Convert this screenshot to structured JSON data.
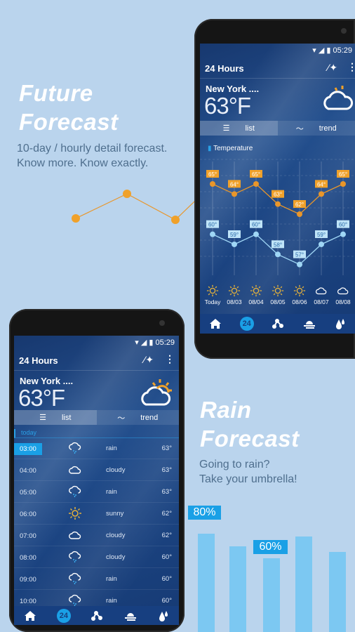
{
  "promo_future": {
    "title1": "Future",
    "title2": "Forecast",
    "sub1": "10-day / hourly detail forecast.",
    "sub2": "Know more. Know exactly."
  },
  "promo_rain": {
    "title1": "Rain",
    "title2": "Forecast",
    "sub1": "Going to rain?",
    "sub2": "Take your umbrella!",
    "bars": [
      80,
      70,
      60,
      78,
      65
    ],
    "labels": [
      {
        "text": "80%"
      },
      {
        "text": "60%"
      }
    ]
  },
  "colors": {
    "background": "#bad4ed",
    "accent": "#1aa0e6",
    "high": "#e9962a",
    "low": "#9fd6f5"
  },
  "phone_trend": {
    "status_time": "05:29",
    "title": "24 Hours",
    "city": "New York",
    "dots": "....",
    "temp": "63°F",
    "tab_list": "list",
    "tab_trend": "trend",
    "chart_label": "Temperature",
    "chart_data": {
      "type": "line",
      "categories": [
        "Today",
        "08/03",
        "08/04",
        "08/05",
        "08/06",
        "08/07",
        "08/08"
      ],
      "series": [
        {
          "values": [
            65,
            64,
            65,
            63,
            62,
            64,
            65
          ]
        },
        {
          "values": [
            60,
            59,
            60,
            58,
            57,
            59,
            60
          ]
        }
      ]
    },
    "icons": [
      "sun",
      "sun",
      "sun",
      "sun",
      "sun",
      "cloud",
      "cloud"
    ]
  },
  "phone_list": {
    "status_time": "05:29",
    "title": "24 Hours",
    "city": "New York",
    "dots": "....",
    "temp": "63°F",
    "tab_list": "list",
    "tab_trend": "trend",
    "section": "today",
    "rows": [
      {
        "time": "03:00",
        "icon": "rain",
        "cond": "rain",
        "temp": "63°"
      },
      {
        "time": "04:00",
        "icon": "cloud",
        "cond": "cloudy",
        "temp": "63°"
      },
      {
        "time": "05:00",
        "icon": "rain",
        "cond": "rain",
        "temp": "63°"
      },
      {
        "time": "06:00",
        "icon": "sun",
        "cond": "sunny",
        "temp": "62°"
      },
      {
        "time": "07:00",
        "icon": "cloud",
        "cond": "cloudy",
        "temp": "62°"
      },
      {
        "time": "08:00",
        "icon": "rain",
        "cond": "cloudy",
        "temp": "60°"
      },
      {
        "time": "09:00",
        "icon": "rain",
        "cond": "rain",
        "temp": "60°"
      },
      {
        "time": "10:00",
        "icon": "rain",
        "cond": "rain",
        "temp": "60°"
      }
    ]
  },
  "nav": {
    "badge": "24"
  }
}
